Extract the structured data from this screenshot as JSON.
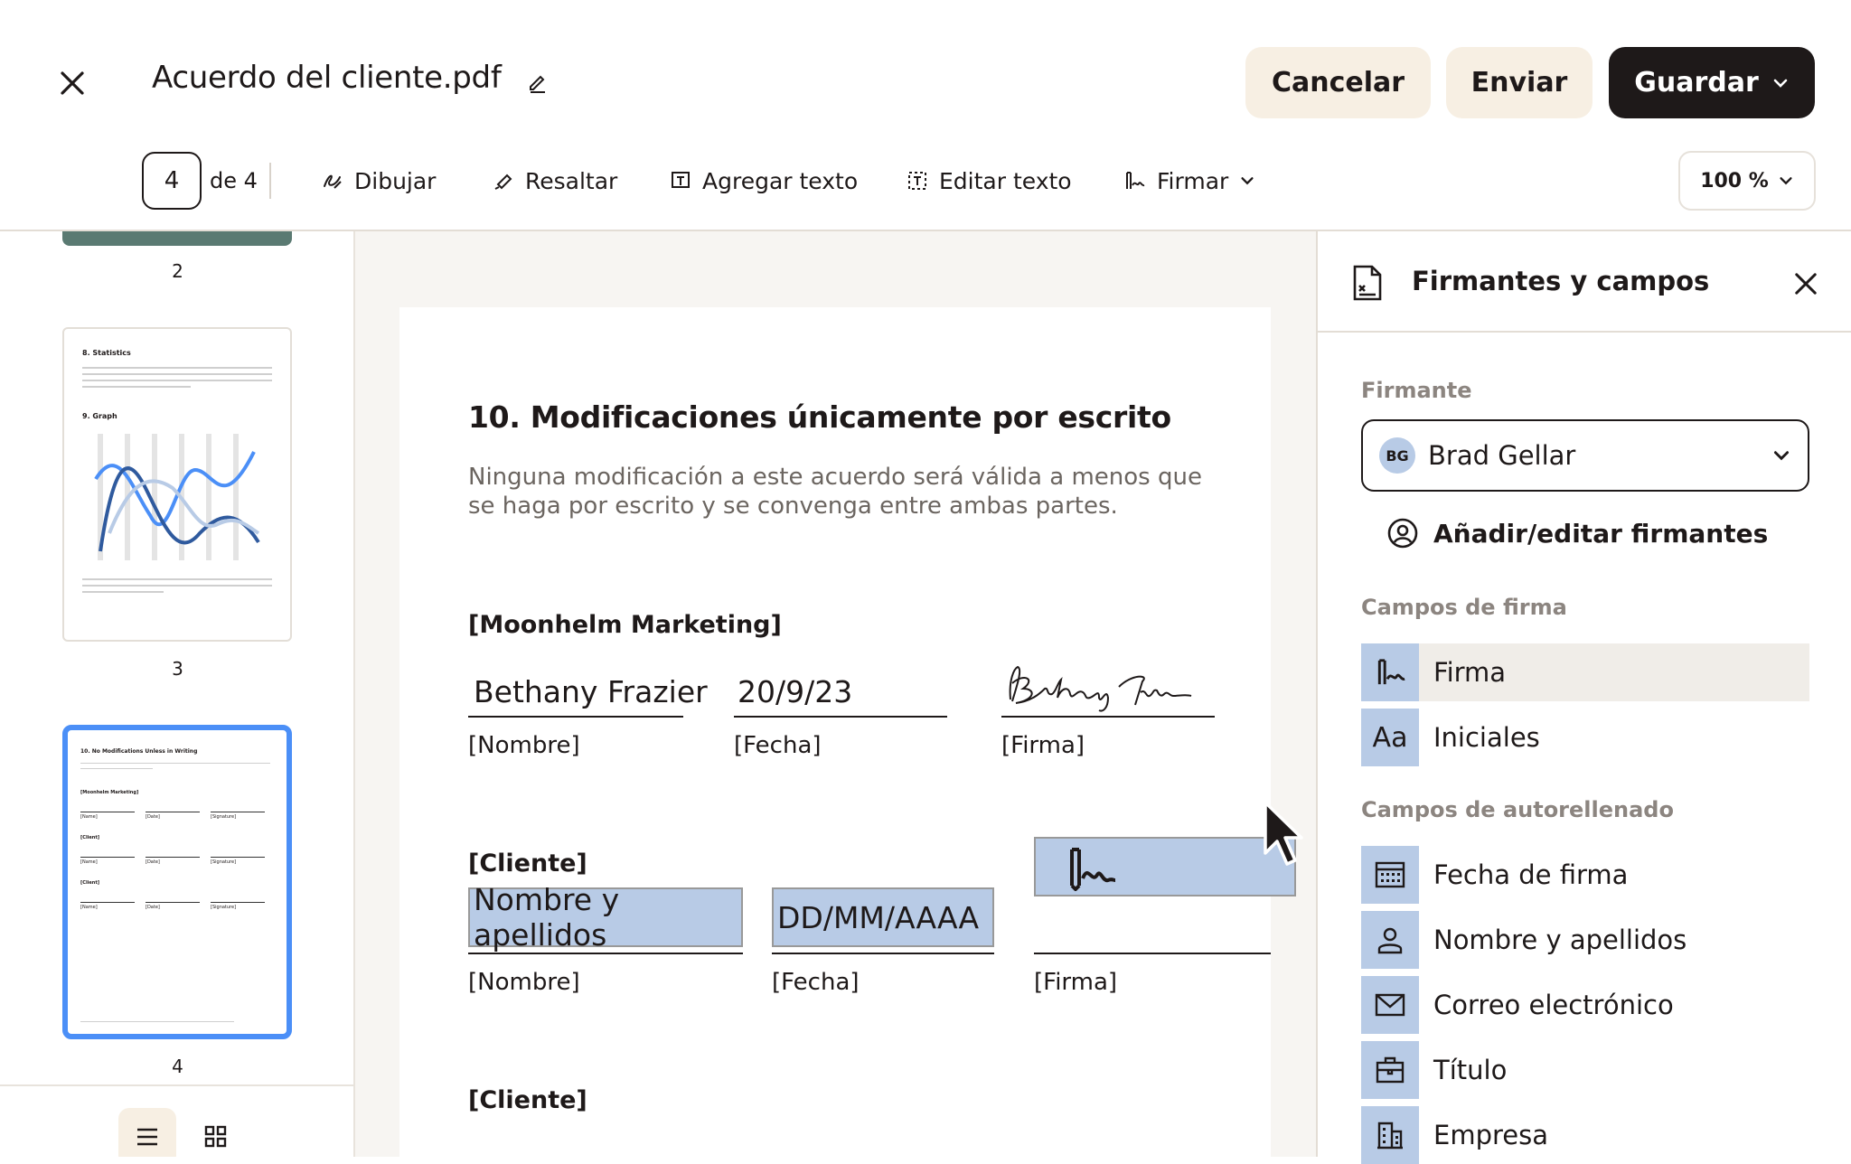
{
  "header": {
    "title": "Acuerdo del cliente.pdf",
    "cancel_label": "Cancelar",
    "send_label": "Enviar",
    "save_label": "Guardar"
  },
  "toolbar": {
    "page_current": "4",
    "page_of": "de 4",
    "tools": [
      {
        "label": "Dibujar",
        "icon": "draw-icon"
      },
      {
        "label": "Resaltar",
        "icon": "highlight-icon"
      },
      {
        "label": "Agregar texto",
        "icon": "add-text-icon"
      },
      {
        "label": "Editar texto",
        "icon": "edit-text-icon"
      },
      {
        "label": "Firmar",
        "icon": "sign-icon"
      }
    ],
    "zoom": "100 %"
  },
  "thumbnails": {
    "pages": [
      "2",
      "3",
      "4"
    ],
    "page3": {
      "heading1": "8. Statistics",
      "heading2": "9. Graph"
    },
    "page4": {
      "heading": "10. No Modifications Unless in Writing",
      "party1": "[Moonhelm Marketing]",
      "party2": "[Client]",
      "party3": "[Client]",
      "name": "[Name]",
      "date": "[Date]",
      "signature": "[Signature]"
    }
  },
  "document": {
    "section_title": "10. Modificaciones únicamente por escrito",
    "section_body": "Ninguna modificación a este acuerdo será válida a menos que se haga por escrito y se convenga entre ambas partes.",
    "party1": "[Moonhelm Marketing]",
    "party1_name": "Bethany Frazier",
    "party1_date": "20/9/23",
    "label_name": "[Nombre]",
    "label_date": "[Fecha]",
    "label_signature": "[Firma]",
    "party2": "[Cliente]",
    "field_name": "Nombre y apellidos",
    "field_date": "DD/MM/AAAA",
    "party3": "[Cliente]"
  },
  "panel": {
    "title": "Firmantes y campos",
    "signer_label": "Firmante",
    "signer_initials": "BG",
    "signer_name": "Brad Gellar",
    "add_signers": "Añadir/editar firmantes",
    "sig_fields_label": "Campos de firma",
    "sig_fields": [
      "Firma",
      "Iniciales"
    ],
    "auto_fields_label": "Campos de autorellenado",
    "auto_fields": [
      "Fecha de firma",
      "Nombre y apellidos",
      "Correo electrónico",
      "Título",
      "Empresa"
    ]
  },
  "colors": {
    "accent": "#4b8ff7",
    "field": "#b8cbe6",
    "button_light": "#f7efe3",
    "button_dark": "#1e1919"
  }
}
